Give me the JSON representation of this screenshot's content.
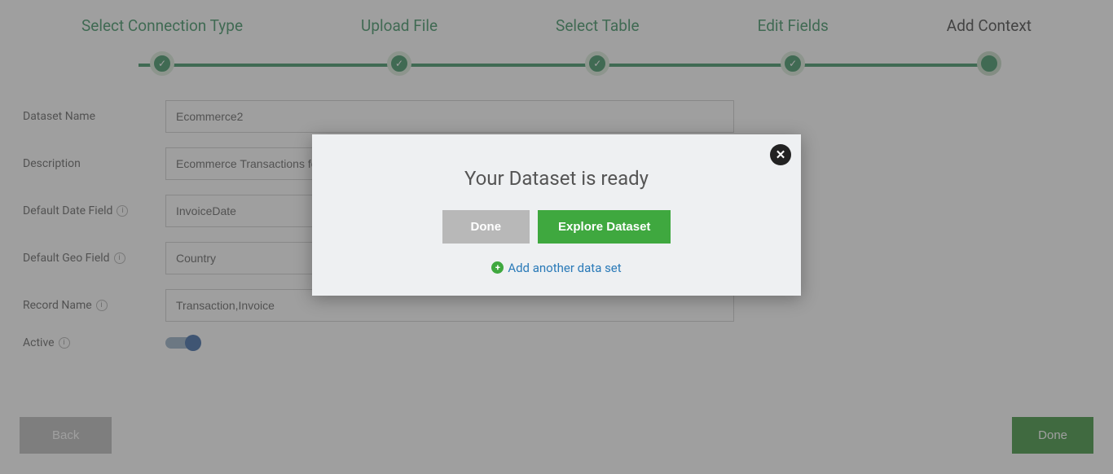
{
  "stepper": {
    "steps": [
      {
        "label": "Select Connection Type",
        "current": false
      },
      {
        "label": "Upload File",
        "current": false
      },
      {
        "label": "Select Table",
        "current": false
      },
      {
        "label": "Edit Fields",
        "current": false
      },
      {
        "label": "Add Context",
        "current": true
      }
    ]
  },
  "form": {
    "dataset_name": {
      "label": "Dataset Name",
      "value": "Ecommerce2"
    },
    "description": {
      "label": "Description",
      "value": "Ecommerce Transactions fo"
    },
    "default_date": {
      "label": "Default Date Field",
      "value": "InvoiceDate"
    },
    "default_geo": {
      "label": "Default Geo Field",
      "value": "Country"
    },
    "record_name": {
      "label": "Record Name",
      "value": "Transaction,Invoice"
    },
    "active": {
      "label": "Active"
    }
  },
  "buttons": {
    "back": "Back",
    "done": "Done"
  },
  "modal": {
    "title": "Your Dataset is ready",
    "done": "Done",
    "explore": "Explore Dataset",
    "link": "Add another data set"
  }
}
